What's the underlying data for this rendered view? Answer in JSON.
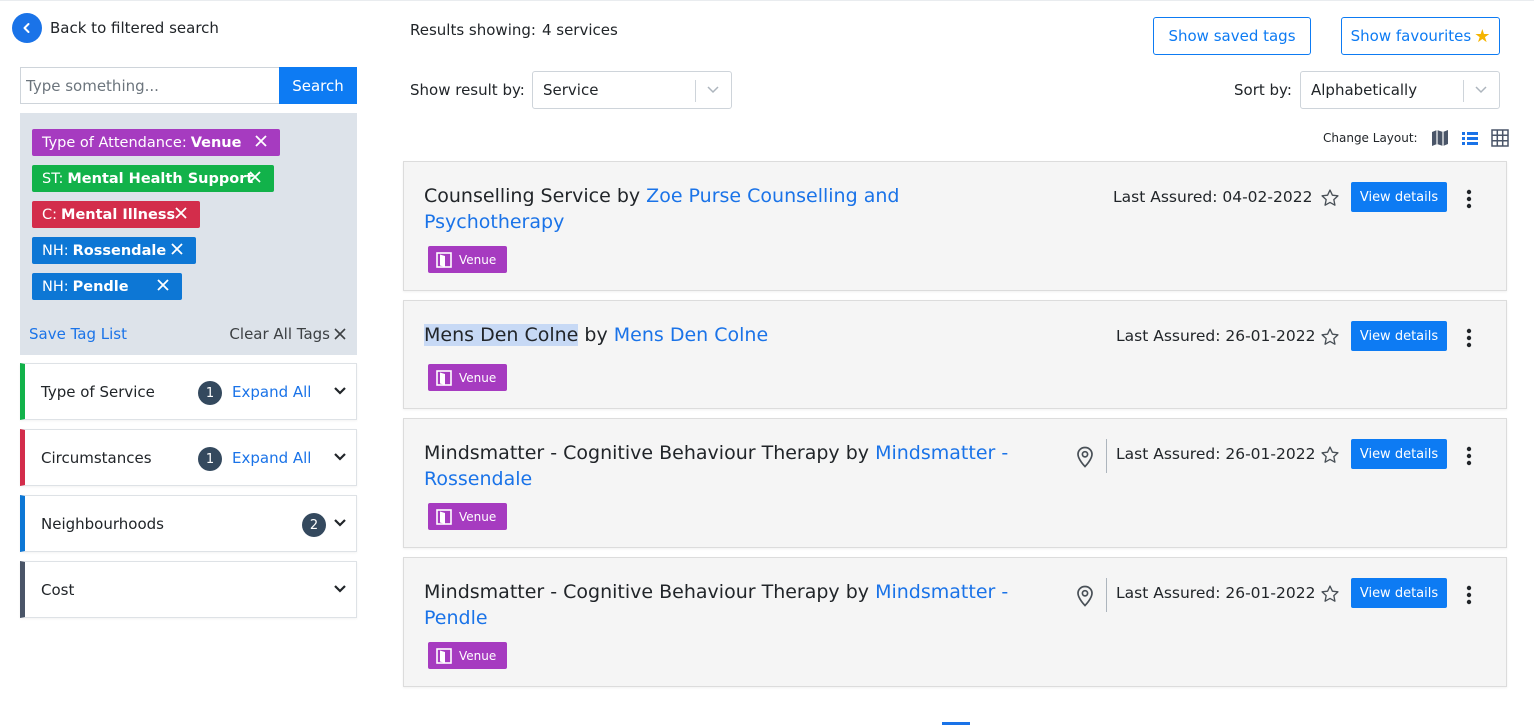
{
  "nav": {
    "back_label": "Back to filtered search"
  },
  "search": {
    "placeholder": "Type something...",
    "value": "",
    "button_label": "Search"
  },
  "tags": [
    {
      "prefix": "Type of Attendance:",
      "value": "Venue",
      "color": "#a63bc0"
    },
    {
      "prefix": "ST:",
      "value": "Mental Health Support",
      "color": "#12b24a"
    },
    {
      "prefix": "C:",
      "value": "Mental Illness",
      "color": "#d32d4b"
    },
    {
      "prefix": "NH:",
      "value": "Rossendale",
      "color": "#0d77d5"
    },
    {
      "prefix": "NH:",
      "value": "Pendle",
      "color": "#0d77d5"
    }
  ],
  "tag_actions": {
    "save_label": "Save Tag List",
    "clear_label": "Clear All Tags"
  },
  "filters": [
    {
      "label": "Type of Service",
      "count": "1",
      "expand_label": "Expand All",
      "color": "#12b24a"
    },
    {
      "label": "Circumstances",
      "count": "1",
      "expand_label": "Expand All",
      "color": "#d32d4b"
    },
    {
      "label": "Neighbourhoods",
      "count": "2",
      "color": "#0d77d5"
    },
    {
      "label": "Cost",
      "color": "#4a5568"
    }
  ],
  "results": {
    "label": "Results showing:",
    "count_text": "4 services"
  },
  "toolbar": {
    "saved_tags_label": "Show saved tags",
    "favourites_label": "Show favourites"
  },
  "show_by": {
    "label": "Show result by:",
    "value": "Service"
  },
  "sort": {
    "label": "Sort by:",
    "value": "Alphabetically"
  },
  "layout": {
    "label": "Change Layout:",
    "icons": [
      "map-icon",
      "list-view-icon",
      "grid-view-icon"
    ],
    "active": "list-view-icon"
  },
  "services": [
    {
      "name": "Counselling Service",
      "by": "by",
      "org": "Zoe Purse Counselling and Psychotherapy",
      "badge": "Venue",
      "assured": "Last Assured: 04-02-2022",
      "button": "View details",
      "has_location": false
    },
    {
      "name": "Mens Den Colne",
      "by": "by",
      "org": "Mens Den Colne",
      "badge": "Venue",
      "assured": "Last Assured: 26-01-2022",
      "button": "View details",
      "has_location": false
    },
    {
      "name": "Mindsmatter - Cognitive Behaviour Therapy",
      "by": "by",
      "org": "Mindsmatter - Rossendale",
      "badge": "Venue",
      "assured": "Last Assured: 26-01-2022",
      "button": "View details",
      "has_location": true
    },
    {
      "name": "Mindsmatter - Cognitive Behaviour Therapy",
      "by": "by",
      "org": "Mindsmatter - Pendle",
      "badge": "Venue",
      "assured": "Last Assured: 26-01-2022",
      "button": "View details",
      "has_location": true
    }
  ]
}
